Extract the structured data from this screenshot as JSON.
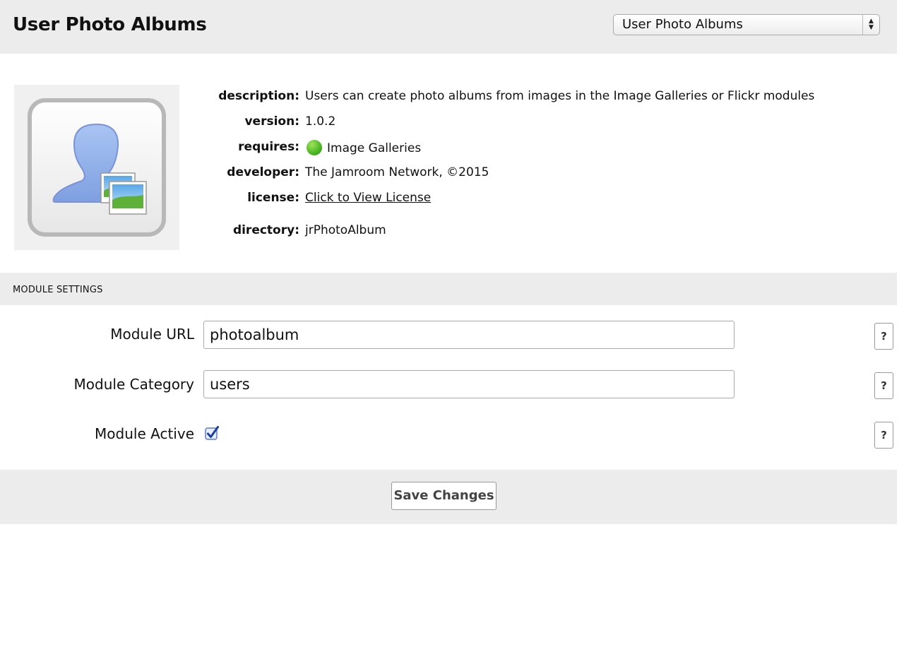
{
  "header": {
    "title": "User Photo Albums",
    "module_select": {
      "selected": "User Photo Albums"
    }
  },
  "module_info": {
    "icon": "user-photo-album-icon",
    "description_label": "description:",
    "description": "Users can create photo albums from images in the Image Galleries or Flickr modules",
    "version_label": "version:",
    "version": "1.0.2",
    "requires_label": "requires:",
    "requires": "Image Galleries",
    "requires_status_color": "#3cae1a",
    "developer_label": "developer:",
    "developer": "The Jamroom Network, ©2015",
    "license_label": "license:",
    "license": "Click to View License",
    "directory_label": "directory:",
    "directory": "jrPhotoAlbum"
  },
  "settings": {
    "section_title": "MODULE SETTINGS",
    "fields": [
      {
        "label": "Module URL",
        "value": "photoalbum"
      },
      {
        "label": "Module Category",
        "value": "users"
      },
      {
        "label": "Module Active",
        "checked": true
      }
    ],
    "help_label": "?",
    "save_label": "Save Changes"
  }
}
